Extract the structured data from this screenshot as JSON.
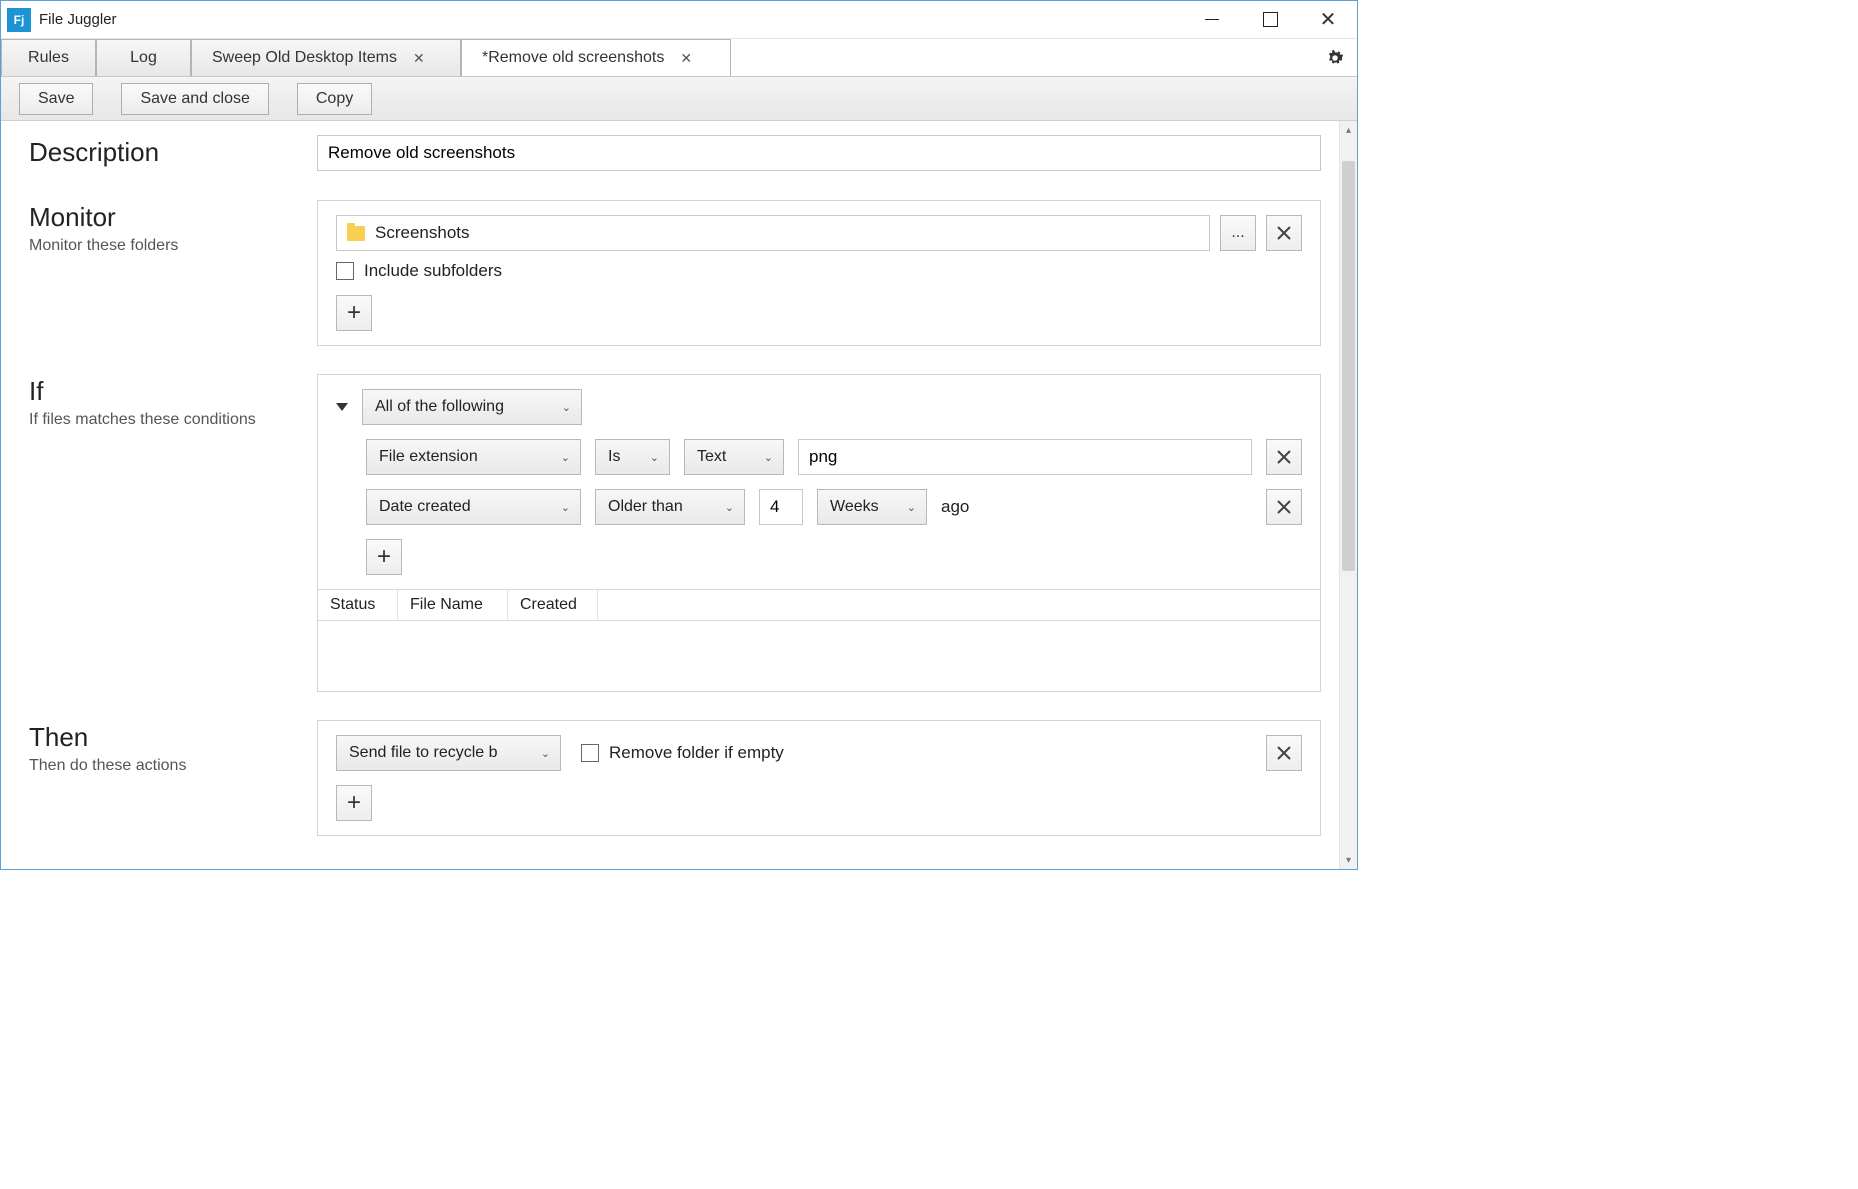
{
  "app": {
    "title": "File Juggler",
    "iconText": "Fj"
  },
  "tabs": {
    "rules": "Rules",
    "log": "Log",
    "sweep": "Sweep Old Desktop Items",
    "remove": "*Remove old screenshots"
  },
  "toolbar": {
    "save": "Save",
    "saveClose": "Save and close",
    "copy": "Copy"
  },
  "description": {
    "label": "Description",
    "value": "Remove old screenshots"
  },
  "monitor": {
    "label": "Monitor",
    "sub": "Monitor these folders",
    "folder": "Screenshots",
    "browse": "...",
    "includeSub": "Include subfolders"
  },
  "if": {
    "label": "If",
    "sub": "If files matches these conditions",
    "mode": "All of the following",
    "cond1": {
      "attr": "File extension",
      "op": "Is",
      "type": "Text",
      "value": "png"
    },
    "cond2": {
      "attr": "Date created",
      "op": "Older than",
      "num": "4",
      "unit": "Weeks",
      "suffix": "ago"
    },
    "cols": {
      "status": "Status",
      "fileName": "File Name",
      "created": "Created"
    }
  },
  "then": {
    "label": "Then",
    "sub": "Then do these actions",
    "action": "Send file to recycle b",
    "removeEmpty": "Remove folder if empty"
  }
}
